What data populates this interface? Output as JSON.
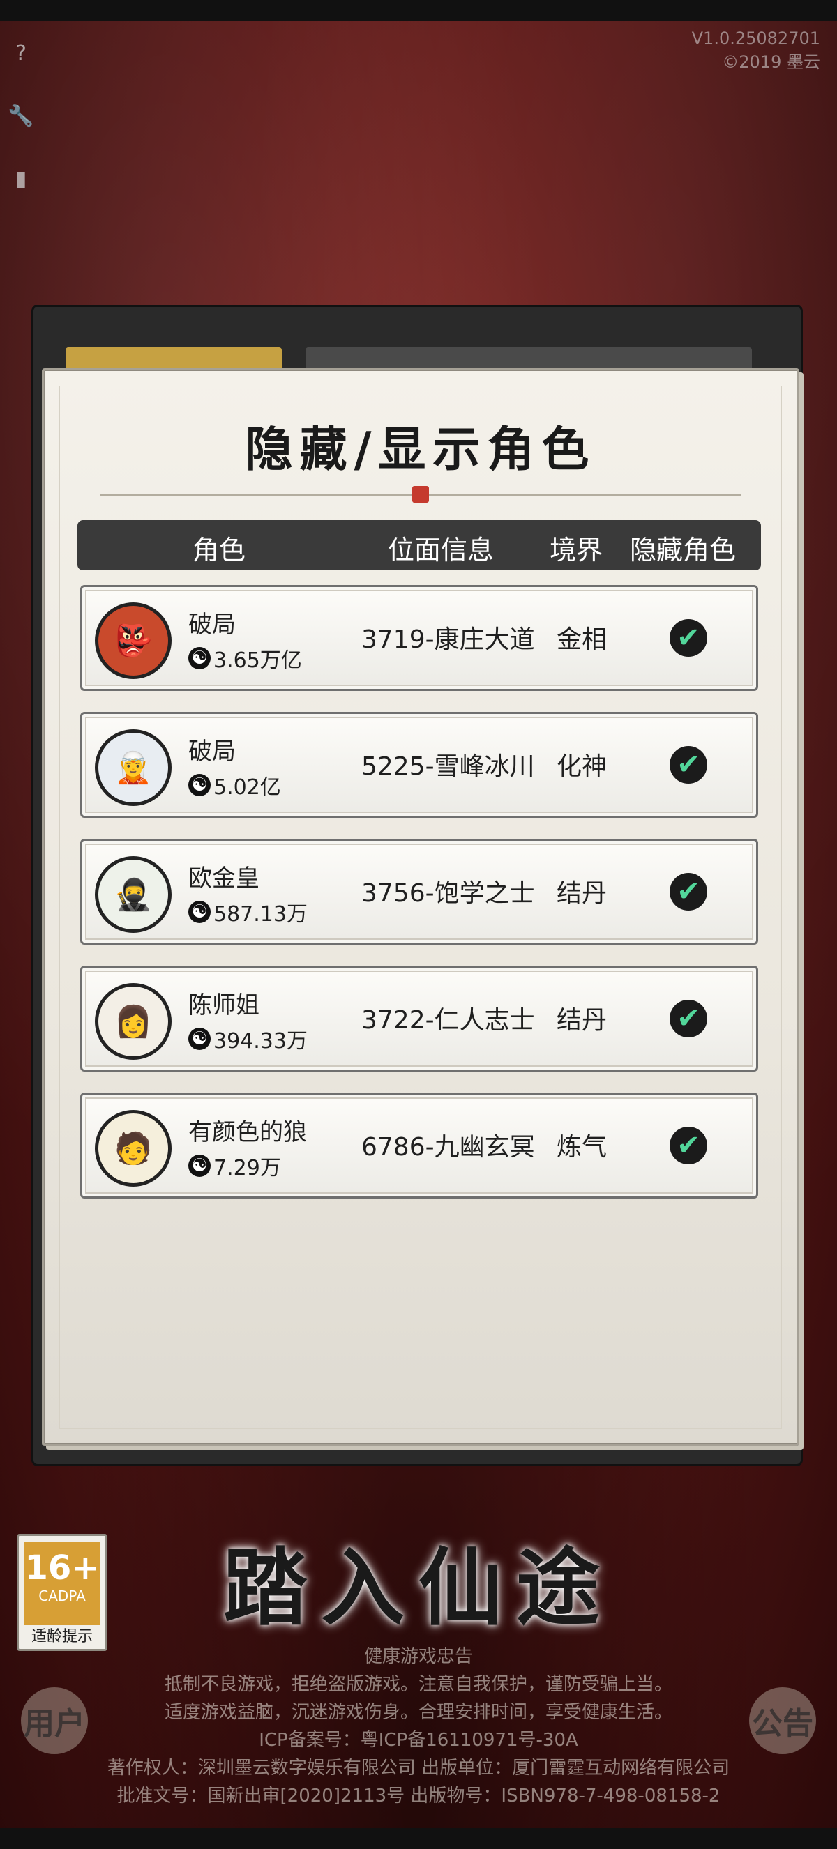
{
  "version": {
    "line1": "V1.0.25082701",
    "line2": "©2019 墨云"
  },
  "side_icons": [
    "help-icon",
    "wrench-icon",
    "signal-icon"
  ],
  "dialog": {
    "title": "隐藏/显示角色",
    "headers": {
      "role": "角色",
      "plane": "位面信息",
      "realm": "境界",
      "hide": "隐藏角色"
    },
    "rows": [
      {
        "name": "破局",
        "power": "3.65万亿",
        "plane": "3719-康庄大道",
        "realm": "金相",
        "hidden": true,
        "avatar": "portrait-warrior-red"
      },
      {
        "name": "破局",
        "power": "5.02亿",
        "plane": "5225-雪峰冰川",
        "realm": "化神",
        "hidden": true,
        "avatar": "portrait-blue-hair"
      },
      {
        "name": "欧金皇",
        "power": "587.13万",
        "plane": "3756-饱学之士",
        "realm": "结丹",
        "hidden": true,
        "avatar": "portrait-green-headband"
      },
      {
        "name": "陈师姐",
        "power": "394.33万",
        "plane": "3722-仁人志士",
        "realm": "结丹",
        "hidden": true,
        "avatar": "portrait-female"
      },
      {
        "name": "有颜色的狼",
        "power": "7.29万",
        "plane": "6786-九幽玄冥",
        "realm": "炼气",
        "hidden": true,
        "avatar": "portrait-yellow-robe"
      }
    ]
  },
  "footer": {
    "enter_title": "踏入仙途",
    "age_rating": {
      "number": "16+",
      "org": "CADPA",
      "label": "适龄提示"
    },
    "health_title": "健康游戏忠告",
    "health_lines": [
      "抵制不良游戏，拒绝盗版游戏。注意自我保护，谨防受骗上当。",
      "适度游戏益脑，沉迷游戏伤身。合理安排时间，享受健康生活。",
      "ICP备案号：粤ICP备16110971号-30A",
      "著作权人：深圳墨云数字娱乐有限公司 出版单位：厦门雷霆互动网络有限公司",
      "批准文号：国新出审[2020]2113号 出版物号：ISBN978-7-498-08158-2"
    ],
    "left_button": "用户",
    "right_button": "公告"
  },
  "colors": {
    "check": "#52d69a",
    "header_bg": "#3a3a3a",
    "seal": "#c53a2e",
    "age_badge": "#d79f35"
  }
}
